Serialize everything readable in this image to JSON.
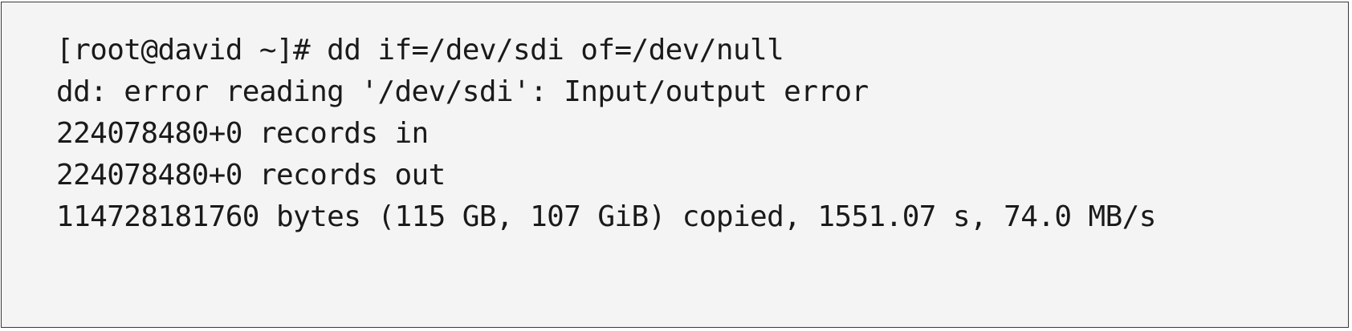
{
  "terminal": {
    "lines": [
      "[root@david ~]# dd if=/dev/sdi of=/dev/null",
      "dd: error reading '/dev/sdi': Input/output error",
      "224078480+0 records in",
      "224078480+0 records out",
      "114728181760 bytes (115 GB, 107 GiB) copied, 1551.07 s, 74.0 MB/s"
    ]
  }
}
